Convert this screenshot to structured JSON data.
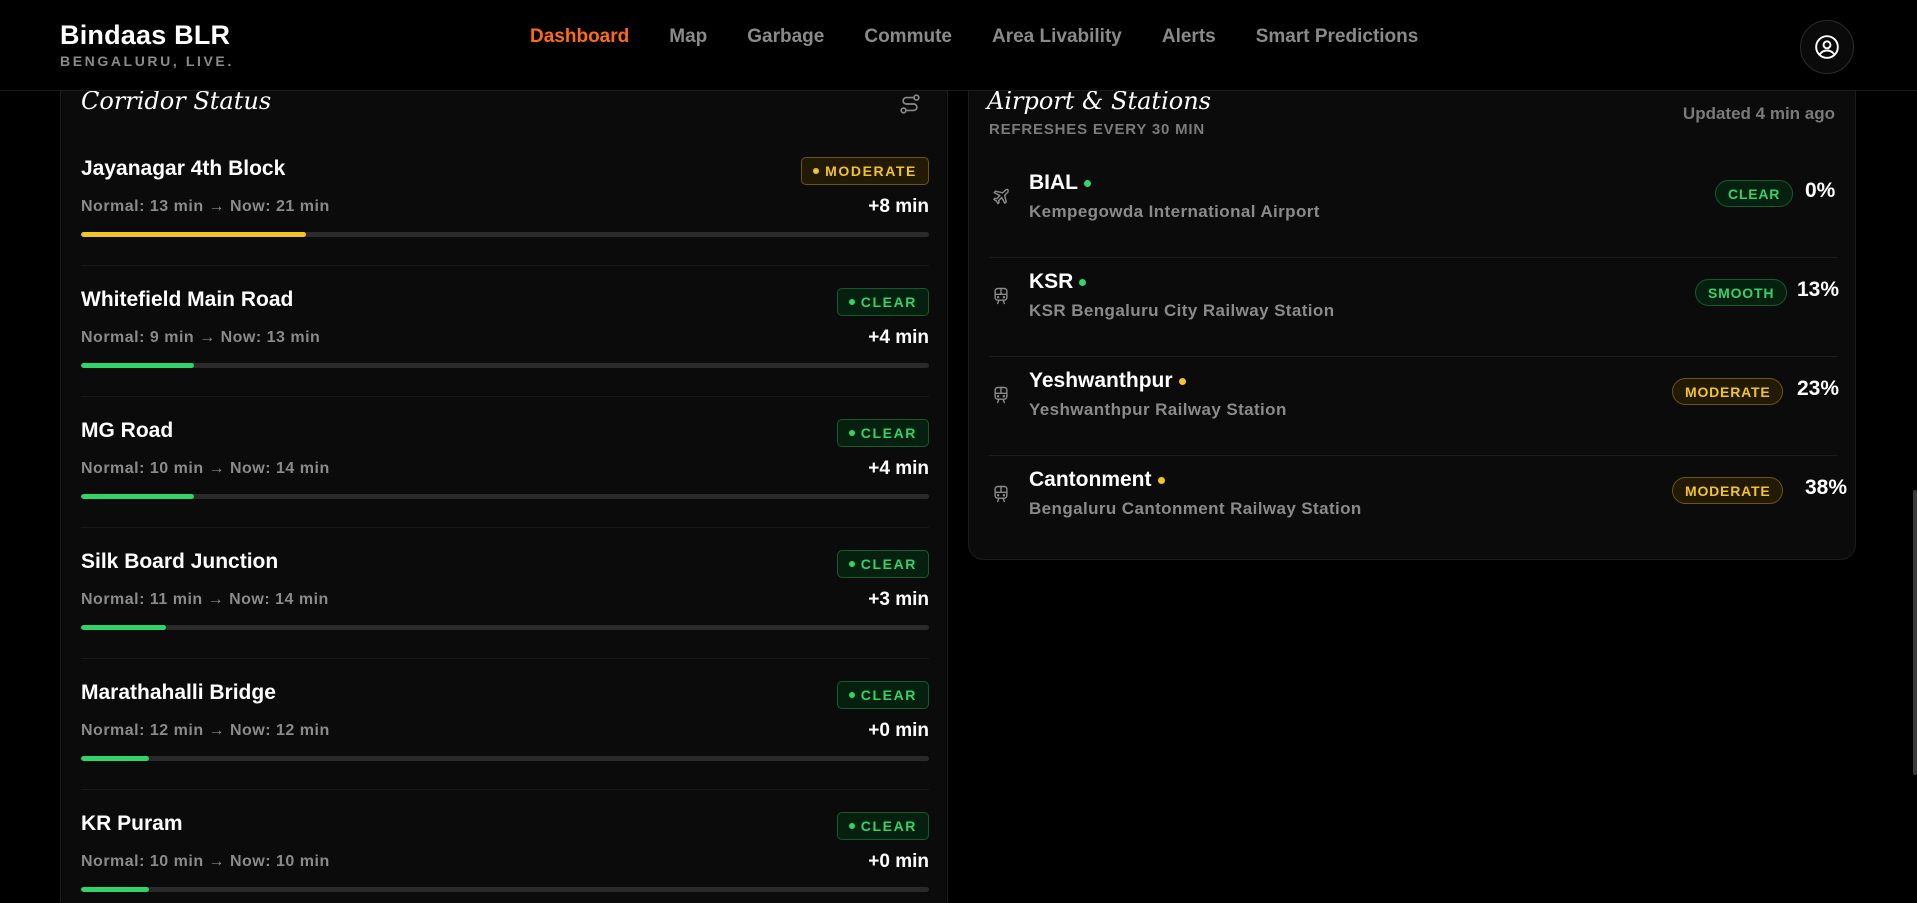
{
  "app": {
    "title": "Bindaas BLR",
    "subtitle": "BENGALURU, LIVE."
  },
  "nav": [
    {
      "label": "Dashboard",
      "active": true
    },
    {
      "label": "Map",
      "active": false
    },
    {
      "label": "Garbage",
      "active": false
    },
    {
      "label": "Commute",
      "active": false
    },
    {
      "label": "Area Livability",
      "active": false
    },
    {
      "label": "Alerts",
      "active": false
    },
    {
      "label": "Smart Predictions",
      "active": false
    }
  ],
  "icons": {
    "user": "user-circle-icon",
    "filter": "route-filter-icon",
    "airport": "plane-icon",
    "train": "train-icon"
  },
  "colors": {
    "accent": "#ff6a13",
    "clear": "#2fd46b",
    "moderate": "#f2c425",
    "background": "#000000",
    "panel": "#0b0b0b"
  },
  "corridor_panel": {
    "title": "Corridor Status",
    "items": [
      {
        "name": "Jayanagar 4th Block",
        "status": "MODERATE",
        "status_color": "yellow",
        "times": "Normal: 13 min → Now: 21 min",
        "delta": "+8 min",
        "load": 0.265
      },
      {
        "name": "Whitefield Main Road",
        "status": "CLEAR",
        "status_color": "green",
        "times": "Normal: 9 min → Now: 13 min",
        "delta": "+4 min",
        "load": 0.133
      },
      {
        "name": "MG Road",
        "status": "CLEAR",
        "status_color": "green",
        "times": "Normal: 10 min → Now: 14 min",
        "delta": "+4 min",
        "load": 0.133
      },
      {
        "name": "Silk Board Junction",
        "status": "CLEAR",
        "status_color": "green",
        "times": "Normal: 11 min → Now: 14 min",
        "delta": "+3 min",
        "load": 0.1
      },
      {
        "name": "Marathahalli Bridge",
        "status": "CLEAR",
        "status_color": "green",
        "times": "Normal: 12 min → Now: 12 min",
        "delta": "+0 min",
        "load": 0.08
      },
      {
        "name": "KR Puram",
        "status": "CLEAR",
        "status_color": "green",
        "times": "Normal: 10 min → Now: 10 min",
        "delta": "+0 min",
        "load": 0.08
      }
    ]
  },
  "stations_panel": {
    "title": "Airport & Stations",
    "refresh_label": "REFRESHES EVERY 30 MIN",
    "updated": "Updated 4 min ago",
    "items": [
      {
        "name": "BIAL",
        "full": "Kempegowda International Airport",
        "status": "CLEAR",
        "status_color": "green",
        "pct": "0%",
        "icon": "plane-icon"
      },
      {
        "name": "KSR",
        "full": "KSR Bengaluru City Railway Station",
        "status": "SMOOTH",
        "status_color": "green",
        "pct": "13%",
        "icon": "train-icon"
      },
      {
        "name": "Yeshwanthpur",
        "full": "Yeshwanthpur Railway Station",
        "status": "MODERATE",
        "status_color": "yellow",
        "pct": "23%",
        "icon": "train-icon"
      },
      {
        "name": "Cantonment",
        "full": "Bengaluru Cantonment Railway Station",
        "status": "MODERATE",
        "status_color": "yellow",
        "pct": "38%",
        "icon": "train-icon"
      }
    ]
  }
}
